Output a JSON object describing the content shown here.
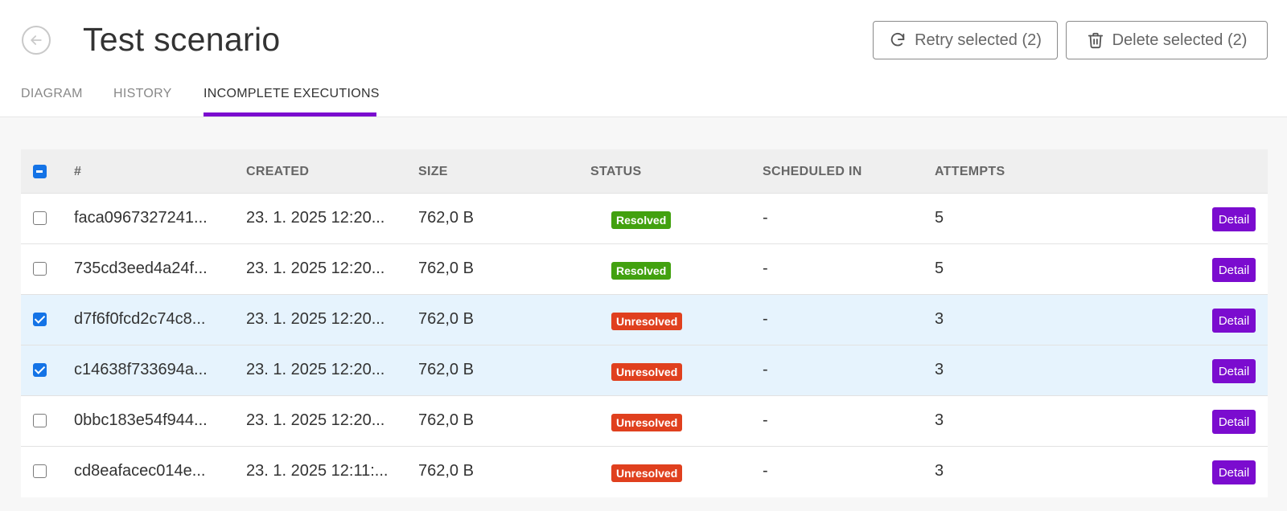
{
  "header": {
    "title": "Test scenario",
    "retry_label": "Retry selected (2)",
    "delete_label": "Delete selected (2)"
  },
  "tabs": [
    {
      "label": "DIAGRAM",
      "active": false
    },
    {
      "label": "HISTORY",
      "active": false
    },
    {
      "label": "INCOMPLETE EXECUTIONS",
      "active": true
    }
  ],
  "table": {
    "columns": [
      "#",
      "CREATED",
      "SIZE",
      "STATUS",
      "SCHEDULED IN",
      "ATTEMPTS"
    ],
    "detail_label": "Detail",
    "rows": [
      {
        "id": "faca0967327241...",
        "created": "23. 1. 2025 12:20...",
        "size": "762,0 B",
        "status": "Resolved",
        "scheduled": "-",
        "attempts": "5",
        "checked": false
      },
      {
        "id": "735cd3eed4a24f...",
        "created": "23. 1. 2025 12:20...",
        "size": "762,0 B",
        "status": "Resolved",
        "scheduled": "-",
        "attempts": "5",
        "checked": false
      },
      {
        "id": "d7f6f0fcd2c74c8...",
        "created": "23. 1. 2025 12:20...",
        "size": "762,0 B",
        "status": "Unresolved",
        "scheduled": "-",
        "attempts": "3",
        "checked": true
      },
      {
        "id": "c14638f733694a...",
        "created": "23. 1. 2025 12:20...",
        "size": "762,0 B",
        "status": "Unresolved",
        "scheduled": "-",
        "attempts": "3",
        "checked": true
      },
      {
        "id": "0bbc183e54f944...",
        "created": "23. 1. 2025 12:20...",
        "size": "762,0 B",
        "status": "Unresolved",
        "scheduled": "-",
        "attempts": "3",
        "checked": false
      },
      {
        "id": "cd8eafacec014e...",
        "created": "23. 1. 2025 12:11:...",
        "size": "762,0 B",
        "status": "Unresolved",
        "scheduled": "-",
        "attempts": "3",
        "checked": false
      }
    ]
  },
  "colors": {
    "accent": "#7b0ccf",
    "resolved": "#42a10f",
    "unresolved": "#e0401e",
    "checkbox": "#1473e6",
    "selected_row": "#e6f3fd"
  },
  "icons": {
    "back": "arrow-left-circle-icon",
    "retry": "refresh-icon",
    "delete": "trash-icon"
  }
}
